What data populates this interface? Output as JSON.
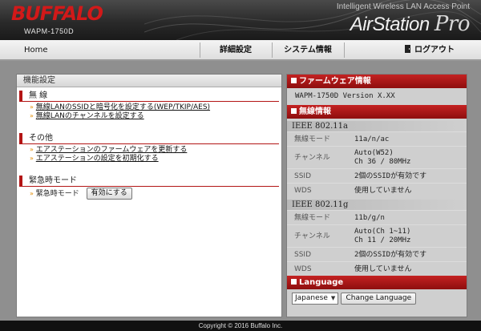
{
  "header": {
    "brand": "BUFFALO",
    "model": "WAPM-1750D",
    "tagline": "Intelligent Wireless LAN Access Point",
    "product_main": "AirStation",
    "product_suffix": "Pro"
  },
  "nav": {
    "home": "Home",
    "detail": "詳細設定",
    "system": "システム情報",
    "logout": "ログアウト"
  },
  "left": {
    "title": "機能設定",
    "sections": {
      "wireless": {
        "title": "無 線",
        "links": [
          "無線LANのSSIDと暗号化を設定する(WEP/TKIP/AES)",
          "無線LANのチャンネルを設定する"
        ]
      },
      "other": {
        "title": "その他",
        "links": [
          "エアステーションのファームウェアを更新する",
          "エアステーションの設定を初期化する"
        ]
      },
      "emergency": {
        "title": "緊急時モード",
        "label": "緊急時モード",
        "button": "有効にする"
      }
    }
  },
  "right": {
    "firmware": {
      "title": "ファームウェア情報",
      "version": "WAPM-1750D Version X.XX"
    },
    "wireless": {
      "title": "無線情報",
      "a": {
        "band": "IEEE 802.11a",
        "mode_label": "無線モード",
        "mode_value": "11a/n/ac",
        "channel_label": "チャンネル",
        "channel_line1": "Auto(W52)",
        "channel_line2": "Ch 36 / 80MHz",
        "ssid_label": "SSID",
        "ssid_value": "2個のSSIDが有効です",
        "wds_label": "WDS",
        "wds_value": "使用していません"
      },
      "g": {
        "band": "IEEE 802.11g",
        "mode_label": "無線モード",
        "mode_value": "11b/g/n",
        "channel_label": "チャンネル",
        "channel_line1": "Auto(Ch 1~11)",
        "channel_line2": "Ch 11 / 20MHz",
        "ssid_label": "SSID",
        "ssid_value": "2個のSSIDが有効です",
        "wds_label": "WDS",
        "wds_value": "使用していません"
      }
    },
    "language": {
      "title": "Language",
      "selected": "Japanese",
      "button": "Change Language"
    }
  },
  "footer": {
    "copyright": "Copyright © 2016 Buffalo Inc."
  },
  "colors": {
    "accent_red": "#b31515",
    "header_dark": "#2a2a2a",
    "link_arrow": "#e08a00"
  }
}
